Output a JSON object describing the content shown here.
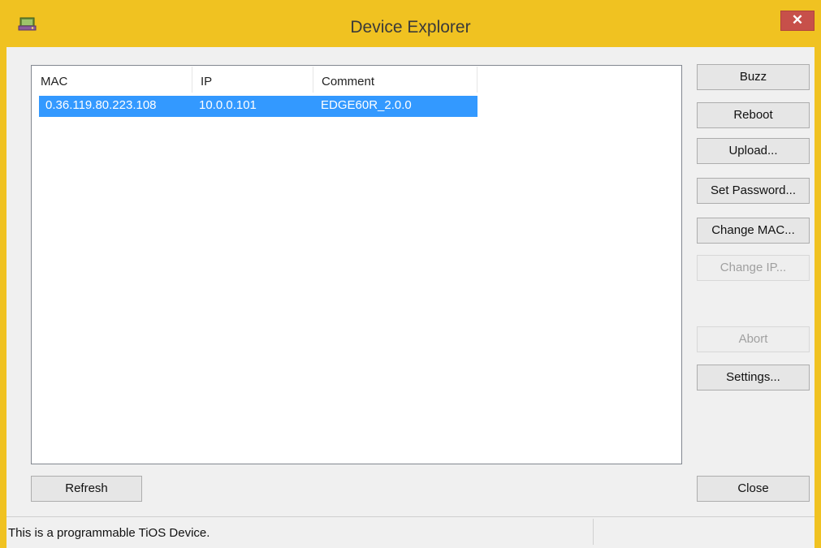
{
  "window": {
    "title": "Device Explorer",
    "close_label": "✕",
    "app_icon": "device-explorer-app-icon",
    "colors": {
      "frame": "#f0c221",
      "close": "#c7504a",
      "selection": "#3399ff"
    }
  },
  "list": {
    "columns": [
      "MAC",
      "IP",
      "Comment"
    ],
    "rows": [
      {
        "mac": "0.36.119.80.223.108",
        "ip": "10.0.0.101",
        "comment": "EDGE60R_2.0.0",
        "selected": true
      }
    ]
  },
  "buttons": {
    "buzz": "Buzz",
    "reboot": "Reboot",
    "upload": "Upload...",
    "set_password": "Set Password...",
    "change_mac": "Change MAC...",
    "change_ip": "Change IP...",
    "abort": "Abort",
    "settings": "Settings...",
    "refresh": "Refresh",
    "close": "Close"
  },
  "status": {
    "text": "This is a programmable TiOS Device."
  }
}
